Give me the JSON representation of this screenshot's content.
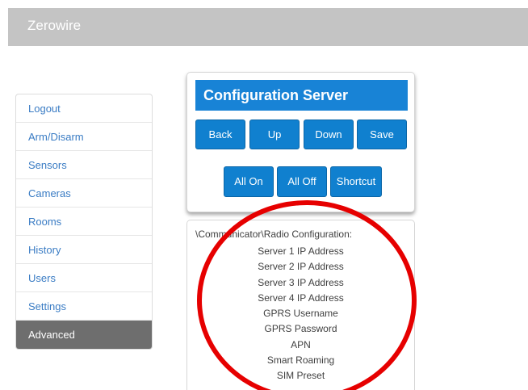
{
  "header": {
    "brand": "Zerowire"
  },
  "sidebar": {
    "items": [
      {
        "label": "Logout"
      },
      {
        "label": "Arm/Disarm"
      },
      {
        "label": "Sensors"
      },
      {
        "label": "Cameras"
      },
      {
        "label": "Rooms"
      },
      {
        "label": "History"
      },
      {
        "label": "Users"
      },
      {
        "label": "Settings"
      },
      {
        "label": "Advanced",
        "active": true
      }
    ]
  },
  "config_panel": {
    "title": "Configuration Server",
    "buttons": {
      "back": "Back",
      "up": "Up",
      "down": "Down",
      "save": "Save",
      "all_on": "All On",
      "all_off": "All Off",
      "shortcut": "Shortcut"
    }
  },
  "list_panel": {
    "path": "\\Communicator\\Radio Configuration:",
    "items": [
      "Server 1 IP Address",
      "Server 2 IP Address",
      "Server 3 IP Address",
      "Server 4 IP Address",
      "GPRS Username",
      "GPRS Password",
      "APN",
      "Smart Roaming",
      "SIM Preset"
    ]
  },
  "colors": {
    "header_bg": "#c4c4c4",
    "accent": "#1883d6",
    "button": "#1080cf",
    "link": "#3a7cc4",
    "active_nav": "#6e6e6e",
    "annotation": "#e60000"
  }
}
